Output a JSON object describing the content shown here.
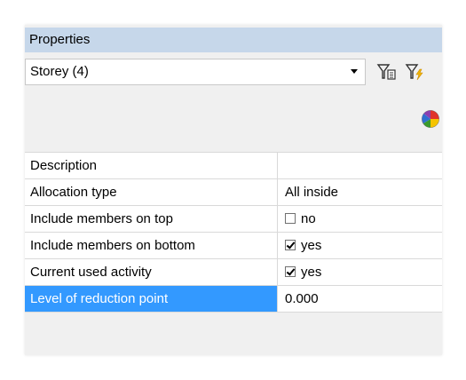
{
  "panel": {
    "title": "Properties"
  },
  "selector": {
    "value": "Storey (4)",
    "icons": [
      "filter-settings-icon",
      "filter-quick-icon",
      "color-pie-icon"
    ]
  },
  "properties": [
    {
      "name": "Description",
      "value": "",
      "type": "text",
      "selected": false
    },
    {
      "name": "Allocation type",
      "value": "All inside",
      "type": "text",
      "selected": false
    },
    {
      "name": "Include members on top",
      "value": "no",
      "type": "checkbox",
      "checked": false,
      "selected": false
    },
    {
      "name": "Include members on bottom",
      "value": "yes",
      "type": "checkbox",
      "checked": true,
      "selected": false
    },
    {
      "name": "Current used activity",
      "value": "yes",
      "type": "checkbox",
      "checked": true,
      "selected": false
    },
    {
      "name": "Level of reduction point",
      "value": "0.000",
      "type": "text",
      "selected": true
    }
  ],
  "colors": {
    "title_bg": "#c6d7ea",
    "selection": "#3399ff"
  }
}
